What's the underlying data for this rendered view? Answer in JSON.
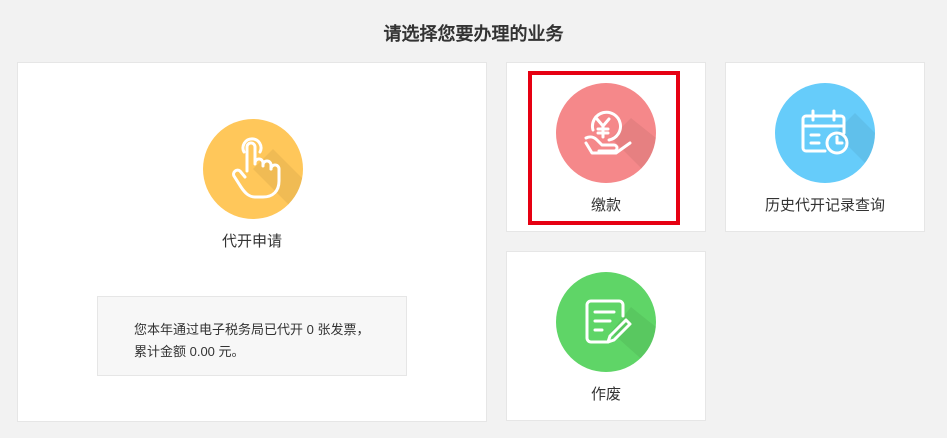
{
  "page": {
    "title": "请选择您要办理的业务"
  },
  "services": {
    "apply": {
      "label": "代开申请",
      "icon": "hand-tap-icon",
      "color": "#ffc75a"
    },
    "pay": {
      "label": "缴款",
      "icon": "yuan-hand-icon",
      "color": "#f5888a"
    },
    "history": {
      "label": "历史代开记录查询",
      "icon": "calendar-clock-icon",
      "color": "#66ccfa"
    },
    "void": {
      "label": "作废",
      "icon": "edit-document-icon",
      "color": "#5fd567"
    }
  },
  "notice": {
    "text": "您本年通过电子税务局已代开 0 张发票，累计金额 0.00 元。"
  },
  "highlight": {
    "color": "#e60012"
  }
}
